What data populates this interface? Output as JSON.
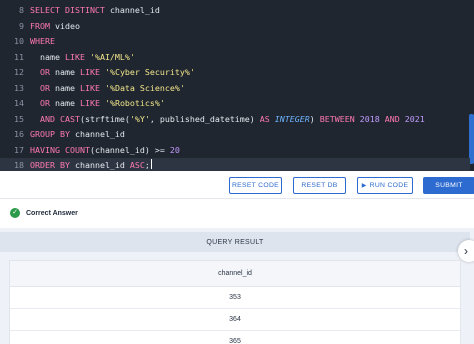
{
  "editor": {
    "lines": [
      {
        "num": "8",
        "tokens": [
          {
            "t": "kw",
            "v": "SELECT DISTINCT "
          },
          {
            "t": "plain",
            "v": "channel_id"
          }
        ]
      },
      {
        "num": "9",
        "tokens": [
          {
            "t": "kw",
            "v": "FROM "
          },
          {
            "t": "plain",
            "v": "video"
          }
        ]
      },
      {
        "num": "10",
        "tokens": [
          {
            "t": "kw",
            "v": "WHERE"
          }
        ]
      },
      {
        "num": "11",
        "tokens": [
          {
            "t": "plain",
            "v": "  name "
          },
          {
            "t": "kw",
            "v": "LIKE "
          },
          {
            "t": "str",
            "v": "'%AI/ML%'"
          }
        ]
      },
      {
        "num": "12",
        "tokens": [
          {
            "t": "kw",
            "v": "  OR "
          },
          {
            "t": "plain",
            "v": "name "
          },
          {
            "t": "kw",
            "v": "LIKE "
          },
          {
            "t": "str",
            "v": "'%Cyber Security%'"
          }
        ]
      },
      {
        "num": "13",
        "tokens": [
          {
            "t": "kw",
            "v": "  OR "
          },
          {
            "t": "plain",
            "v": "name "
          },
          {
            "t": "kw",
            "v": "LIKE "
          },
          {
            "t": "str",
            "v": "'%Data Science%'"
          }
        ]
      },
      {
        "num": "14",
        "tokens": [
          {
            "t": "kw",
            "v": "  OR "
          },
          {
            "t": "plain",
            "v": "name "
          },
          {
            "t": "kw",
            "v": "LIKE "
          },
          {
            "t": "str",
            "v": "'%Robotics%'"
          }
        ]
      },
      {
        "num": "15",
        "tokens": [
          {
            "t": "kw",
            "v": "  AND CAST"
          },
          {
            "t": "plain",
            "v": "(strftime("
          },
          {
            "t": "str",
            "v": "'%Y'"
          },
          {
            "t": "plain",
            "v": ", published_datetime) "
          },
          {
            "t": "kw",
            "v": "AS "
          },
          {
            "t": "typ",
            "v": "INTEGER"
          },
          {
            "t": "plain",
            "v": ") "
          },
          {
            "t": "kw",
            "v": "BETWEEN "
          },
          {
            "t": "num",
            "v": "2018"
          },
          {
            "t": "kw",
            "v": " AND "
          },
          {
            "t": "num",
            "v": "2021"
          }
        ]
      },
      {
        "num": "16",
        "tokens": [
          {
            "t": "kw",
            "v": "GROUP BY "
          },
          {
            "t": "plain",
            "v": "channel_id"
          }
        ]
      },
      {
        "num": "17",
        "tokens": [
          {
            "t": "kw",
            "v": "HAVING COUNT"
          },
          {
            "t": "plain",
            "v": "(channel_id) >= "
          },
          {
            "t": "num",
            "v": "20"
          }
        ]
      },
      {
        "num": "18",
        "tokens": [
          {
            "t": "kw",
            "v": "ORDER BY "
          },
          {
            "t": "plain",
            "v": "channel_id "
          },
          {
            "t": "kw",
            "v": "ASC"
          },
          {
            "t": "plain",
            "v": ";"
          }
        ],
        "active": true
      }
    ]
  },
  "toolbar": {
    "reset_code": "RESET CODE",
    "reset_db": "RESET DB",
    "run_code": "RUN CODE",
    "submit": "SUBMIT"
  },
  "status": {
    "text": "Correct Answer",
    "icon": "check-circle-icon",
    "color": "#2b9a49"
  },
  "result": {
    "header": "QUERY RESULT",
    "columns": [
      "channel_id"
    ],
    "rows": [
      "353",
      "364",
      "365"
    ]
  },
  "colors": {
    "accent": "#2d6bd0",
    "editor_bg": "#1f2630"
  }
}
